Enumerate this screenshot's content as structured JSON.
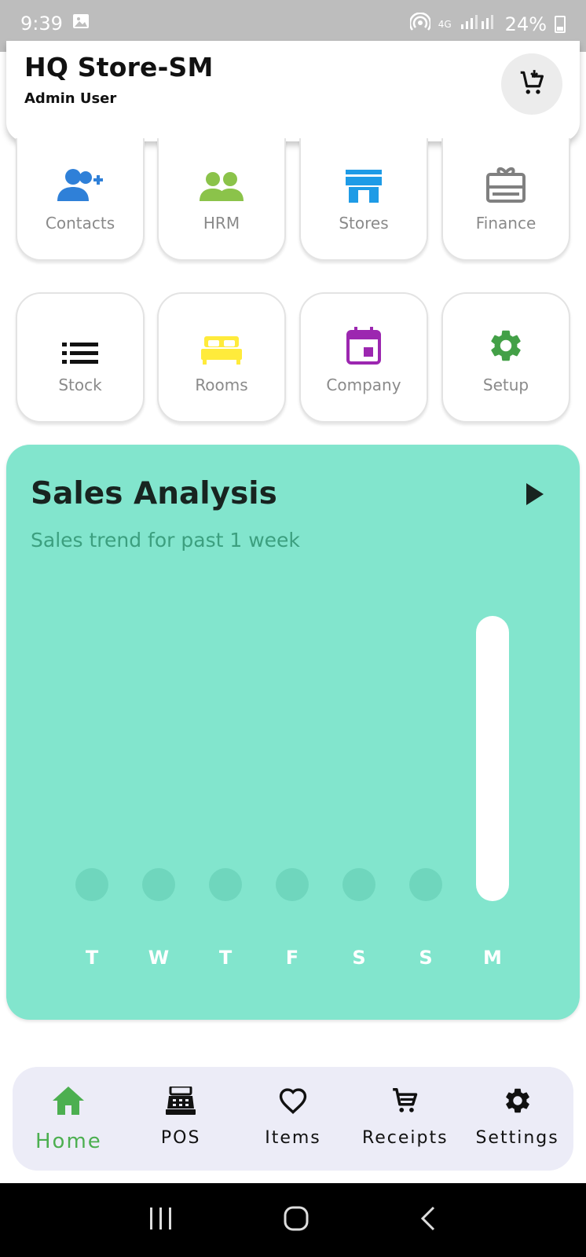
{
  "status_bar": {
    "time": "9:39",
    "network": "4G",
    "battery": "24%"
  },
  "header": {
    "store_name": "HQ Store-SM",
    "user_name": "Admin User",
    "cart_icon": "cart-icon"
  },
  "tiles_row1": [
    {
      "label": "Contacts",
      "icon": "add-contact-icon",
      "color": "#2f80d8"
    },
    {
      "label": "HRM",
      "icon": "people-icon",
      "color": "#8bc34a"
    },
    {
      "label": "Stores",
      "icon": "storefront-icon",
      "color": "#1e9be6"
    },
    {
      "label": "Finance",
      "icon": "card-giftcard-icon",
      "color": "#808080"
    }
  ],
  "tiles_row2": [
    {
      "label": "Stock",
      "icon": "list-icon",
      "color": "#111111"
    },
    {
      "label": "Rooms",
      "icon": "bed-icon",
      "color": "#ffeb3b"
    },
    {
      "label": "Company",
      "icon": "calendar-icon",
      "color": "#9c27b0"
    },
    {
      "label": "Setup",
      "icon": "gear-icon",
      "color": "#43a047"
    }
  ],
  "sales": {
    "title": "Sales Analysis",
    "subtitle": "Sales trend for past 1 week"
  },
  "chart_data": {
    "type": "bar",
    "categories": [
      "T",
      "W",
      "T",
      "F",
      "S",
      "S",
      "M"
    ],
    "values": [
      0,
      0,
      0,
      0,
      0,
      0,
      100
    ],
    "ylim": [
      0,
      100
    ],
    "bar_color": "#ffffff",
    "empty_color": "#6fd6bd"
  },
  "bottom_nav": [
    {
      "label": "Home",
      "icon": "home-icon",
      "active": true
    },
    {
      "label": "POS",
      "icon": "cash-register-icon",
      "active": false
    },
    {
      "label": "Items",
      "icon": "heart-icon",
      "active": false
    },
    {
      "label": "Receipts",
      "icon": "cart-icon",
      "active": false
    },
    {
      "label": "Settings",
      "icon": "gear-icon",
      "active": false
    }
  ]
}
